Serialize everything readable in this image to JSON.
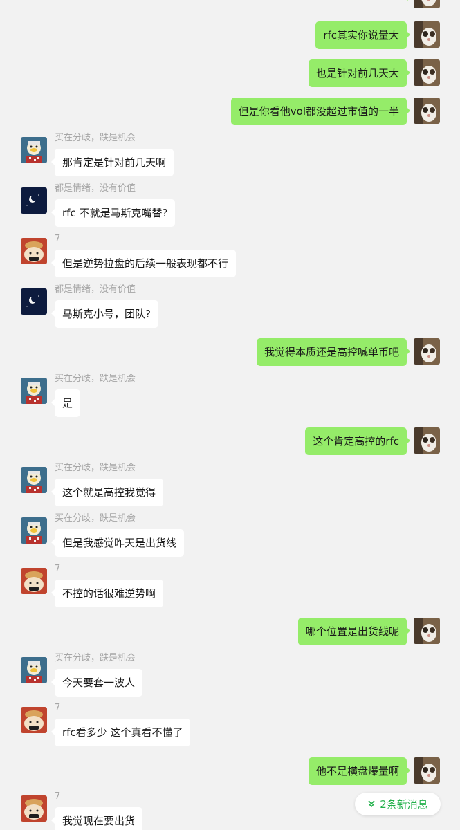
{
  "colors": {
    "background": "#f2f2f2",
    "outgoing_bubble": "#95ec69",
    "incoming_bubble": "#ffffff",
    "sender_name": "#a6a6a6",
    "accent_green": "#21b04a"
  },
  "senders": {
    "buy": "买在分歧，跌是机会",
    "emotion": "都是情绪，没有价值",
    "seven": "7"
  },
  "messages": [
    {
      "side": "right",
      "avatar": "cat-avatar",
      "text": ""
    },
    {
      "side": "right",
      "avatar": "cat-avatar",
      "text": "rfc其实你说量大"
    },
    {
      "side": "right",
      "avatar": "cat-avatar",
      "text": "也是针对前几天大"
    },
    {
      "side": "right",
      "avatar": "cat-avatar",
      "text": "但是你看他vol都没超过市值的一半"
    },
    {
      "side": "left",
      "avatar": "duck-avatar",
      "text": "那肯定是针对前几天啊"
    },
    {
      "side": "left",
      "avatar": "moon-avatar",
      "text": "rfc 不就是马斯克嘴替?"
    },
    {
      "side": "left",
      "avatar": "bread-avatar",
      "text": "但是逆势拉盘的后续一般表现都不行"
    },
    {
      "side": "left",
      "avatar": "moon-avatar",
      "text": "马斯克小号，团队?"
    },
    {
      "side": "right",
      "avatar": "cat-avatar",
      "text": "我觉得本质还是高控喊单币吧"
    },
    {
      "side": "left",
      "avatar": "duck-avatar",
      "text": "是"
    },
    {
      "side": "right",
      "avatar": "cat-avatar",
      "text": "这个肯定高控的rfc"
    },
    {
      "side": "left",
      "avatar": "duck-avatar",
      "text": "这个就是高控我觉得"
    },
    {
      "side": "left",
      "avatar": "duck-avatar",
      "text": "但是我感觉昨天是出货线"
    },
    {
      "side": "left",
      "avatar": "bread-avatar",
      "text": "不控的话很难逆势啊"
    },
    {
      "side": "right",
      "avatar": "cat-avatar",
      "text": "哪个位置是出货线呢"
    },
    {
      "side": "left",
      "avatar": "duck-avatar",
      "text": "今天要套一波人"
    },
    {
      "side": "left",
      "avatar": "bread-avatar",
      "text": "rfc看多少 这个真看不懂了"
    },
    {
      "side": "right",
      "avatar": "cat-avatar",
      "text": "他不是横盘爆量啊"
    },
    {
      "side": "left",
      "avatar": "bread-avatar",
      "text": "我觉现在要出货"
    }
  ],
  "new_messages_label": "2条新消息",
  "new_messages_icon": "double-chevron-down-icon"
}
